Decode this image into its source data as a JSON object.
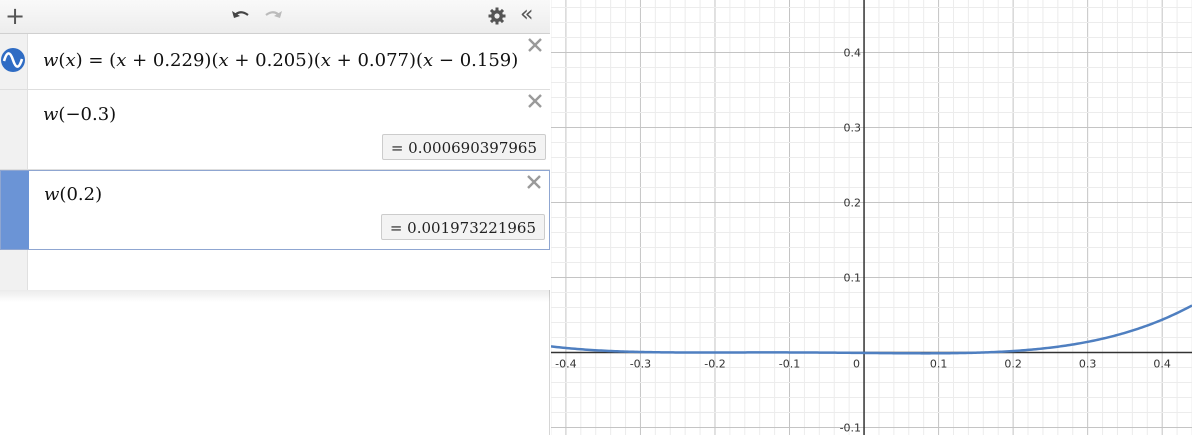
{
  "toolbar": {
    "add_label": "+",
    "collapse_label": "«"
  },
  "expressions": [
    {
      "parts": [
        "w",
        "(",
        "x",
        ")",
        " = ",
        "(",
        "x",
        " + 0.229",
        ")",
        "(",
        "x",
        " + 0.205",
        ")",
        "(",
        "x",
        " + 0.077",
        ")",
        "(",
        "x",
        " − 0.159",
        ")"
      ],
      "result": ""
    },
    {
      "parts": [
        "w",
        "(",
        "−0.3",
        ")"
      ],
      "result": "= 0.000690397965"
    },
    {
      "parts": [
        "w",
        "(",
        "0.2",
        ")"
      ],
      "result": "= 0.001973221965"
    }
  ],
  "colors": {
    "curve": "#4f7fc0",
    "selected_tab": "#6b94d6",
    "function_icon": "#2f6cc4"
  },
  "graph": {
    "x_ticks": [
      "-0.4",
      "-0.3",
      "-0.2",
      "-0.1",
      "0",
      "0.1",
      "0.2",
      "0.3",
      "0.4"
    ],
    "y_ticks": [
      "0.4",
      "0.3",
      "0.2",
      "0.1",
      "-0.1"
    ],
    "x_range": [
      -0.42,
      0.44
    ],
    "y_range": [
      -0.11,
      0.47
    ],
    "grid": true
  },
  "chart_data": {
    "type": "line",
    "title": "",
    "xlabel": "",
    "ylabel": "",
    "xlim": [
      -0.42,
      0.44
    ],
    "ylim": [
      -0.11,
      0.47
    ],
    "x": [
      -0.42,
      -0.4,
      -0.3,
      -0.2,
      -0.1,
      0,
      0.1,
      0.2,
      0.3,
      0.4,
      0.44
    ],
    "y": [
      0.0059,
      0.0039,
      0.0007,
      0.0,
      0.0,
      -0.0006,
      -0.0007,
      0.002,
      0.0169,
      0.0578,
      0.0856
    ],
    "series": [
      {
        "name": "w(x) = (x + 0.229)(x + 0.205)(x + 0.077)(x − 0.159)"
      }
    ]
  }
}
